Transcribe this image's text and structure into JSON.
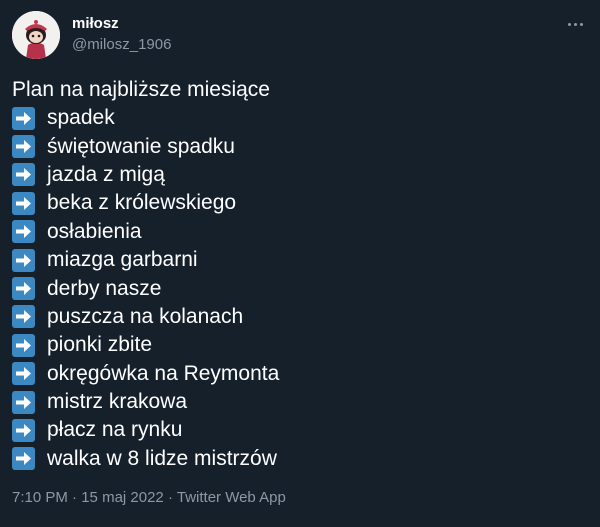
{
  "author": {
    "display_name": "miłosz",
    "handle": "@milosz_1906",
    "avatar_icon": "cartoon-character-avatar"
  },
  "tweet": {
    "headline": "Plan na najbliższe miesiące",
    "bullet_icon": "right-arrow-emoji-icon",
    "items": [
      "spadek",
      "świętowanie spadku",
      "jazda z migą",
      "beka z królewskiego",
      "osłabienia",
      "miazga garbarni",
      "derby nasze",
      "puszcza na kolanach",
      "pionki zbite",
      "okręgówka na Reymonta",
      "mistrz krakowa",
      "płacz na rynku",
      "walka w 8 lidze mistrzów"
    ]
  },
  "meta": {
    "time": "7:10 PM",
    "separator": "·",
    "date": "15 maj 2022",
    "source": "Twitter Web App"
  },
  "colors": {
    "background": "#15202b",
    "text": "#ffffff",
    "secondary_text": "#8b98a5",
    "arrow_emoji": "#3b88c3"
  }
}
